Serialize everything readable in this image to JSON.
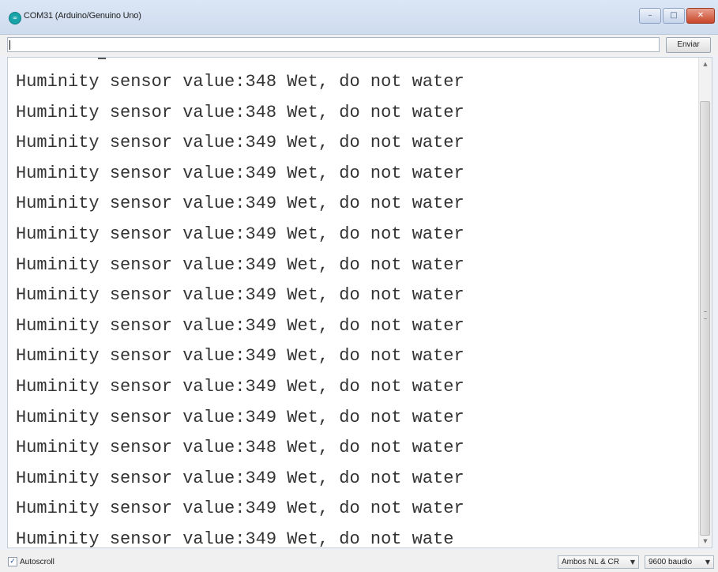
{
  "window": {
    "title": "COM31 (Arduino/Genuino Uno)",
    "icon_glyph": "∞",
    "controls": {
      "minimize_glyph": "–",
      "maximize_glyph": "□",
      "close_glyph": "✕"
    },
    "colors": {
      "titlebar": "#cfdcee",
      "close_button": "#c8452a",
      "app_icon": "#18a3a9"
    }
  },
  "send_bar": {
    "input_value": "",
    "send_label": "Enviar"
  },
  "output": {
    "lines": [
      "Huminity sensor value:348 Wet, do not water",
      "Huminity sensor value:348 Wet, do not water",
      "Huminity sensor value:349 Wet, do not water",
      "Huminity sensor value:349 Wet, do not water",
      "Huminity sensor value:349 Wet, do not water",
      "Huminity sensor value:349 Wet, do not water",
      "Huminity sensor value:349 Wet, do not water",
      "Huminity sensor value:349 Wet, do not water",
      "Huminity sensor value:349 Wet, do not water",
      "Huminity sensor value:349 Wet, do not water",
      "Huminity sensor value:349 Wet, do not water",
      "Huminity sensor value:349 Wet, do not water",
      "Huminity sensor value:348 Wet, do not water",
      "Huminity sensor value:349 Wet, do not water",
      "Huminity sensor value:349 Wet, do not water",
      "Huminity sensor value:349 Wet, do not wate"
    ],
    "scroll": {
      "up_glyph": "▲",
      "down_glyph": "▼"
    }
  },
  "status_bar": {
    "autoscroll_label": "Autoscroll",
    "autoscroll_checked_glyph": "✓",
    "line_ending_value": "Ambos NL & CR",
    "baud_value": "9600 baudio",
    "dropdown_glyph": "▼"
  }
}
